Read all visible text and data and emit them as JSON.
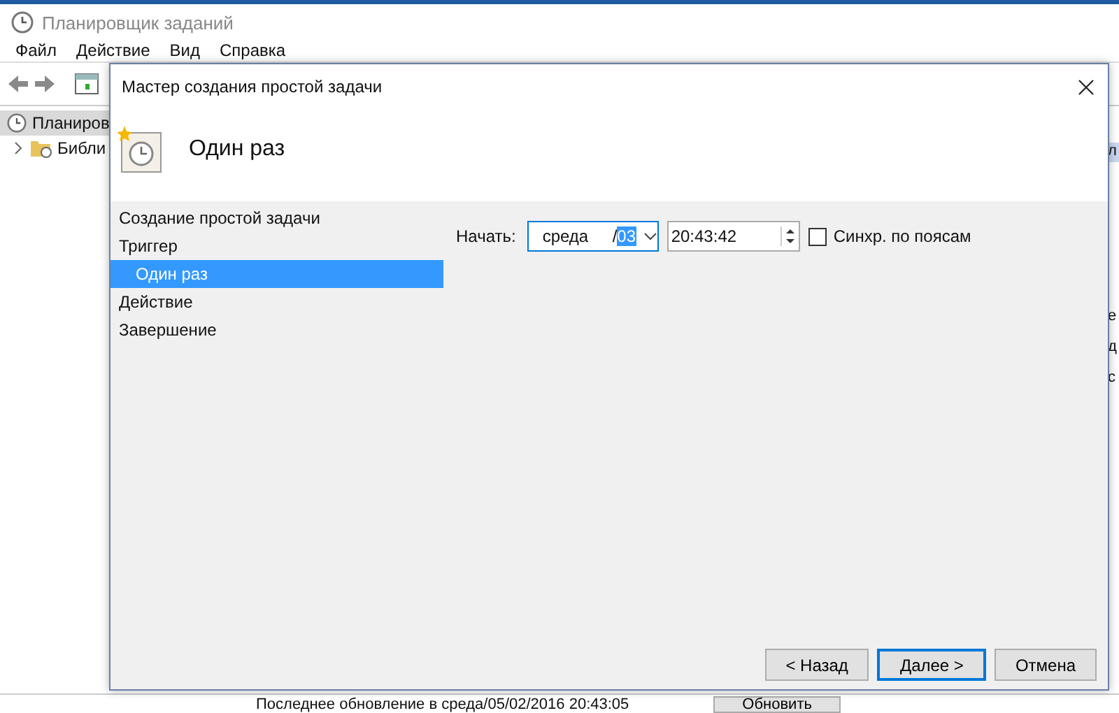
{
  "background_window": {
    "title": "Планировщик заданий",
    "menu": [
      "Файл",
      "Действие",
      "Вид",
      "Справка"
    ],
    "tree": [
      {
        "label": "Планиров",
        "selected": true,
        "children": [
          {
            "label": "Библи",
            "selected": false,
            "expanded": false
          }
        ]
      }
    ],
    "right_fragments": [
      "л",
      "е",
      "д",
      "с"
    ],
    "status_text": "Последнее обновление в среда/05/02/2016 20:43:05",
    "refresh_button": "Обновить"
  },
  "dialog": {
    "title": "Мастер создания простой задачи",
    "heading": "Один раз",
    "steps": [
      {
        "label": "Создание простой задачи",
        "selected": false
      },
      {
        "label": "Триггер",
        "selected": false,
        "children": [
          {
            "label": "Один раз",
            "selected": true
          }
        ]
      },
      {
        "label": "Действие",
        "selected": false
      },
      {
        "label": "Завершение",
        "selected": false
      }
    ],
    "start": {
      "label": "Начать:",
      "date_day": "среда",
      "date_separator": "/",
      "date_highlighted": "03",
      "time": "20:43:42"
    },
    "sync": {
      "label": "Синхр. по поясам",
      "checked": false
    },
    "buttons": [
      {
        "label": "< Назад",
        "default": false
      },
      {
        "label": "Далее >",
        "default": true
      },
      {
        "label": "Отмена",
        "default": false
      }
    ]
  }
}
